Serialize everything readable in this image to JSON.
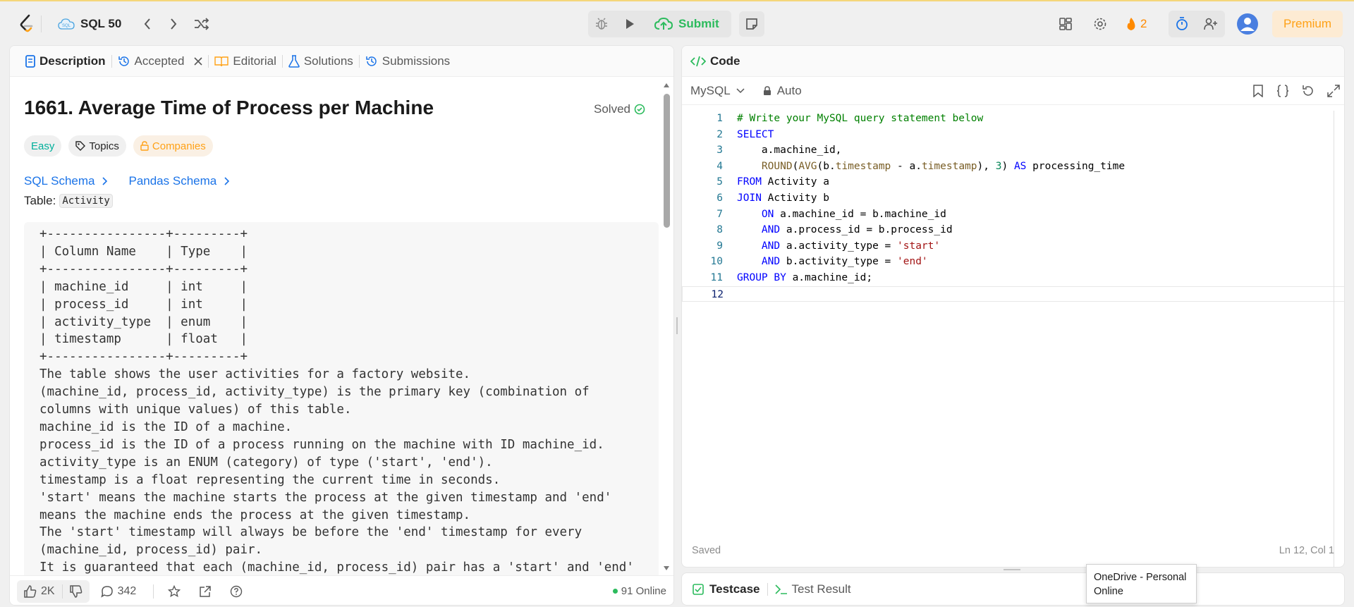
{
  "topbar": {
    "list_title": "SQL 50",
    "submit_label": "Submit",
    "streak_count": "2",
    "premium_label": "Premium"
  },
  "left": {
    "tabs": [
      {
        "label": "Description"
      },
      {
        "label": "Accepted"
      },
      {
        "label": "Editorial"
      },
      {
        "label": "Solutions"
      },
      {
        "label": "Submissions"
      }
    ],
    "title": "1661. Average Time of Process per Machine",
    "solved_label": "Solved",
    "tags": {
      "difficulty": "Easy",
      "topics": "Topics",
      "companies": "Companies"
    },
    "schema_links": {
      "sql": "SQL Schema",
      "pandas": "Pandas Schema"
    },
    "table_label": "Table:",
    "table_name": "Activity",
    "body_text": "+----------------+---------+\n| Column Name    | Type    |\n+----------------+---------+\n| machine_id     | int     |\n| process_id     | int     |\n| activity_type  | enum    |\n| timestamp      | float   |\n+----------------+---------+\nThe table shows the user activities for a factory website.\n(machine_id, process_id, activity_type) is the primary key (combination of\ncolumns with unique values) of this table.\nmachine_id is the ID of a machine.\nprocess_id is the ID of a process running on the machine with ID machine_id.\nactivity_type is an ENUM (category) of type ('start', 'end').\ntimestamp is a float representing the current time in seconds.\n'start' means the machine starts the process at the given timestamp and 'end'\nmeans the machine ends the process at the given timestamp.\nThe 'start' timestamp will always be before the 'end' timestamp for every\n(machine_id, process_id) pair.\nIt is guaranteed that each (machine_id, process_id) pair has a 'start' and 'end'",
    "footer": {
      "likes": "2K",
      "comments": "342",
      "online": "91 Online"
    }
  },
  "code_panel": {
    "title": "Code",
    "language": "MySQL",
    "auto_label": "Auto",
    "lines": [
      [
        {
          "t": "# Write your MySQL query statement below",
          "c": "cm"
        }
      ],
      [
        {
          "t": "SELECT",
          "c": "kw"
        }
      ],
      [
        {
          "t": "    a.machine_id,",
          "c": "plain"
        }
      ],
      [
        {
          "t": "    ",
          "c": "plain"
        },
        {
          "t": "ROUND",
          "c": "fn"
        },
        {
          "t": "(",
          "c": "plain"
        },
        {
          "t": "AVG",
          "c": "fn"
        },
        {
          "t": "(b.",
          "c": "plain"
        },
        {
          "t": "timestamp",
          "c": "fn"
        },
        {
          "t": " - a.",
          "c": "plain"
        },
        {
          "t": "timestamp",
          "c": "fn"
        },
        {
          "t": "), ",
          "c": "plain"
        },
        {
          "t": "3",
          "c": "num"
        },
        {
          "t": ") ",
          "c": "plain"
        },
        {
          "t": "AS",
          "c": "kw"
        },
        {
          "t": " processing_time",
          "c": "plain"
        }
      ],
      [
        {
          "t": "FROM",
          "c": "kw"
        },
        {
          "t": " Activity a",
          "c": "plain"
        }
      ],
      [
        {
          "t": "JOIN",
          "c": "kw"
        },
        {
          "t": " Activity b",
          "c": "plain"
        }
      ],
      [
        {
          "t": "    ",
          "c": "plain"
        },
        {
          "t": "ON",
          "c": "kw"
        },
        {
          "t": " a.machine_id = b.machine_id",
          "c": "plain"
        }
      ],
      [
        {
          "t": "    ",
          "c": "plain"
        },
        {
          "t": "AND",
          "c": "kw"
        },
        {
          "t": " a.process_id = b.process_id",
          "c": "plain"
        }
      ],
      [
        {
          "t": "    ",
          "c": "plain"
        },
        {
          "t": "AND",
          "c": "kw"
        },
        {
          "t": " a.activity_type = ",
          "c": "plain"
        },
        {
          "t": "'start'",
          "c": "str"
        }
      ],
      [
        {
          "t": "    ",
          "c": "plain"
        },
        {
          "t": "AND",
          "c": "kw"
        },
        {
          "t": " b.activity_type = ",
          "c": "plain"
        },
        {
          "t": "'end'",
          "c": "str"
        }
      ],
      [
        {
          "t": "GROUP BY",
          "c": "kw"
        },
        {
          "t": " a.machine_id;",
          "c": "plain"
        }
      ],
      [
        {
          "t": "",
          "c": "plain"
        }
      ]
    ],
    "status": "Saved",
    "cursor": "Ln 12, Col 1"
  },
  "test_panel": {
    "testcase_label": "Testcase",
    "result_label": "Test Result"
  },
  "tooltip": {
    "line1": "OneDrive - Personal",
    "line2": "Online"
  },
  "colors": {
    "accent_blue": "#1a73e8",
    "submit_green": "#2cbb5d",
    "easy_teal": "#00af9b",
    "premium_orange": "#ffa116"
  }
}
